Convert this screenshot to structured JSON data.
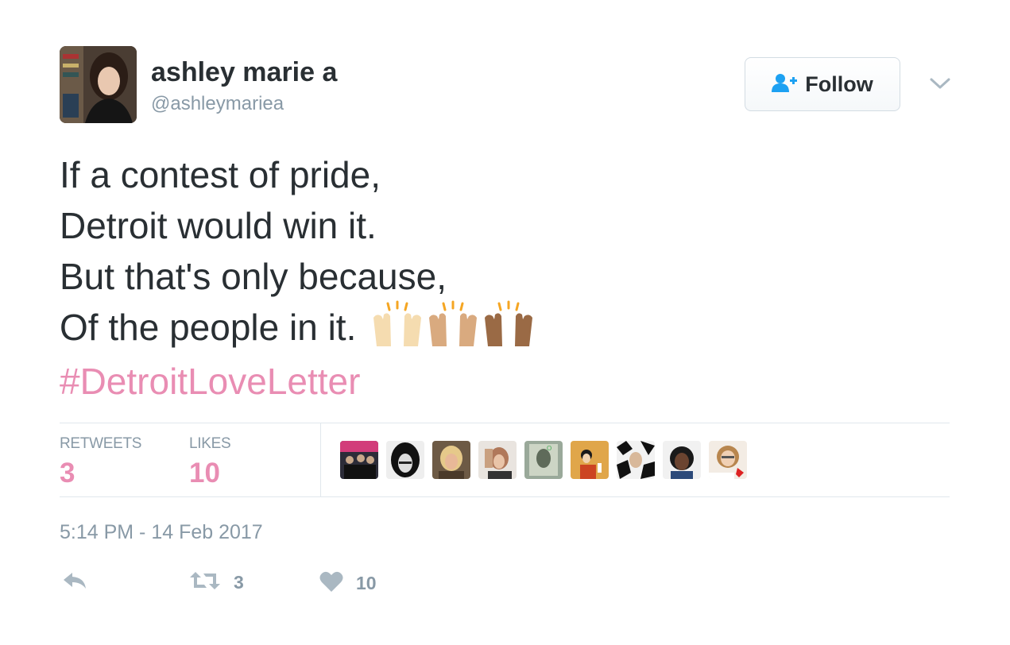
{
  "user": {
    "name": "ashley marie a",
    "handle": "@ashleymariea"
  },
  "follow_button": {
    "label": "Follow"
  },
  "tweet": {
    "lines": [
      "If a contest of pride,",
      "Detroit would win it.",
      "But that's only because,",
      "Of the people in it."
    ],
    "hashtag": "#DetroitLoveLetter",
    "emoji": [
      "raising-hands-light",
      "raising-hands-medium-light",
      "raising-hands-medium-dark"
    ]
  },
  "stats": {
    "retweets_label": "RETWEETS",
    "retweets": "3",
    "likes_label": "LIKES",
    "likes": "10"
  },
  "likers": [
    "liker-avatar-1",
    "liker-avatar-2",
    "liker-avatar-3",
    "liker-avatar-4",
    "liker-avatar-5",
    "liker-avatar-6",
    "liker-avatar-7",
    "liker-avatar-8",
    "liker-avatar-9"
  ],
  "timestamp": "5:14 PM - 14 Feb 2017",
  "actions": {
    "retweet_count": "3",
    "like_count": "10"
  },
  "colors": {
    "accent_pink": "#e98db3",
    "muted": "#8899a6",
    "text": "#292f33",
    "link_blue": "#1da1f2"
  }
}
